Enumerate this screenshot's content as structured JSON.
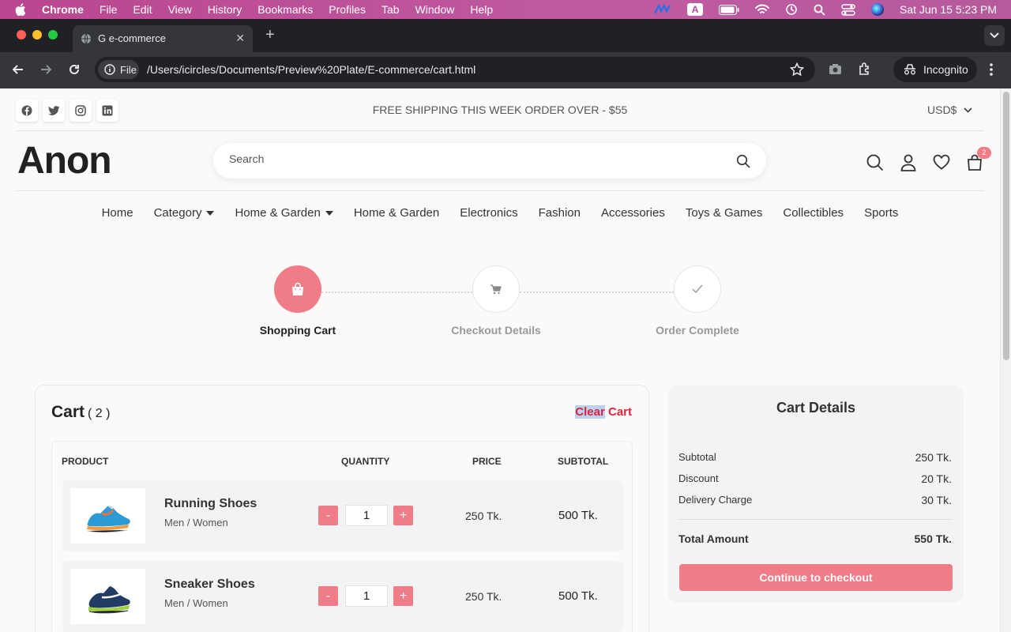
{
  "menubar": {
    "app": "Chrome",
    "items": [
      "File",
      "Edit",
      "View",
      "History",
      "Bookmarks",
      "Profiles",
      "Tab",
      "Window",
      "Help"
    ],
    "input_source": "A",
    "clock": "Sat Jun 15  5:23 PM"
  },
  "browser": {
    "tab_title": "G e-commerce",
    "chip_label": "File",
    "url": "/Users/icircles/Documents/Preview%20Plate/E-commerce/cart.html",
    "incognito_label": "Incognito"
  },
  "site": {
    "promo": "FREE SHIPPING THIS WEEK ORDER OVER - $55",
    "currency": "USD$",
    "logo": "Anon",
    "search_placeholder": "Search",
    "cart_count": "2",
    "accent_color": "#f07c87"
  },
  "nav": {
    "items": [
      "Home",
      "Category",
      "Home & Garden",
      "Home & Garden",
      "Electronics",
      "Fashion",
      "Accessories",
      "Toys & Games",
      "Collectibles",
      "Sports"
    ]
  },
  "steps": [
    {
      "label": "Shopping Cart",
      "state": "active"
    },
    {
      "label": "Checkout Details",
      "state": "pending"
    },
    {
      "label": "Order Complete",
      "state": "pending"
    }
  ],
  "cart": {
    "title": "Cart",
    "count": "( 2 )",
    "clear_selected": "Clear",
    "clear_rest": " Cart",
    "headers": {
      "product": "PRODUCT",
      "quantity": "QUANTITY",
      "price": "PRICE",
      "subtotal": "SUBTOTAL"
    },
    "items": [
      {
        "name": "Running Shoes",
        "category": "Men / Women",
        "qty": "1",
        "price": "250 Tk.",
        "subtotal": "500 Tk.",
        "minus": "-",
        "plus": "+"
      },
      {
        "name": "Sneaker Shoes",
        "category": "Men / Women",
        "qty": "1",
        "price": "250 Tk.",
        "subtotal": "500 Tk.",
        "minus": "-",
        "plus": "+"
      }
    ]
  },
  "details": {
    "title": "Cart Details",
    "subtotal_label": "Subtotal",
    "subtotal": "250 Tk.",
    "discount_label": "Discount",
    "discount": "20 Tk.",
    "delivery_label": "Delivery Charge",
    "delivery": "30 Tk.",
    "total_label": "Total Amount",
    "total": "550 Tk.",
    "checkout_label": "Continue to checkout"
  }
}
